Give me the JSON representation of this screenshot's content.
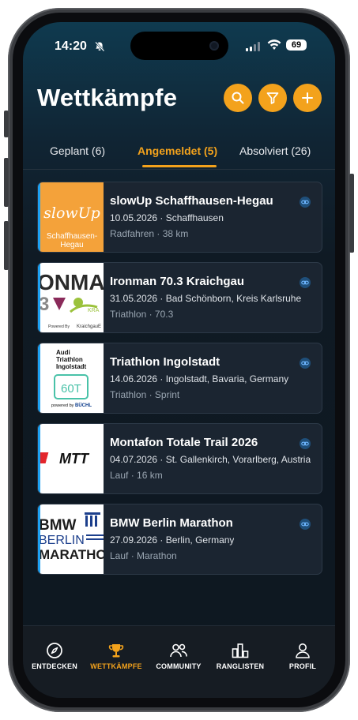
{
  "status_bar": {
    "time": "14:20",
    "battery": "69"
  },
  "header": {
    "title": "Wettkämpfe"
  },
  "tabs": [
    {
      "label": "Geplant (6)"
    },
    {
      "label": "Angemeldet (5)",
      "active": true
    },
    {
      "label": "Absolviert (26)"
    }
  ],
  "events": [
    {
      "name": "slowUp Schaffhausen-Hegau",
      "date_location": "10.05.2026 · Schaffhausen",
      "meta": "Radfahren · 38 km",
      "logo": {
        "main": "slowUp",
        "sub": "Schaffhausen-\nHegau",
        "bg": "#f4a23a"
      }
    },
    {
      "name": "Ironman 70.3 Kraichgau",
      "date_location": "31.05.2026 · Bad Schönborn, Kreis Karlsruhe",
      "meta": "Triathlon · 70.3",
      "logo": {
        "main": "ONMA",
        "sub": "Powered By",
        "sub2": "KraichgauE",
        "tag": "KRA"
      }
    },
    {
      "name": "Triathlon Ingolstadt",
      "date_location": "14.06.2026 · Ingolstadt, Bavaria, Germany",
      "meta": "Triathlon · Sprint",
      "logo": {
        "l1": "Audi",
        "l2": "Triathlon",
        "l3": "Ingolstadt",
        "sub": "powered by BÜCHL"
      }
    },
    {
      "name": "Montafon Totale Trail 2026",
      "date_location": "04.07.2026 · St. Gallenkirch, Vorarlberg, Austria",
      "meta": "Lauf · 16 km",
      "logo": {
        "main": "MTT"
      }
    },
    {
      "name": "BMW Berlin Marathon",
      "date_location": "27.09.2026 · Berlin, Germany",
      "meta": "Lauf · Marathon",
      "logo": {
        "l1": "BMW",
        "l2": "BERLIN",
        "l3": "MARATHON"
      }
    }
  ],
  "bottom_nav": [
    {
      "label": "ENTDECKEN",
      "icon": "compass-icon"
    },
    {
      "label": "WETTKÄMPFE",
      "icon": "trophy-icon",
      "active": true
    },
    {
      "label": "COMMUNITY",
      "icon": "people-icon"
    },
    {
      "label": "RANGLISTEN",
      "icon": "bar-chart-icon"
    },
    {
      "label": "PROFIL",
      "icon": "person-icon"
    }
  ],
  "colors": {
    "accent": "#f3a21c",
    "link_blue": "#1da1f2",
    "card_bg": "#1b2531"
  }
}
